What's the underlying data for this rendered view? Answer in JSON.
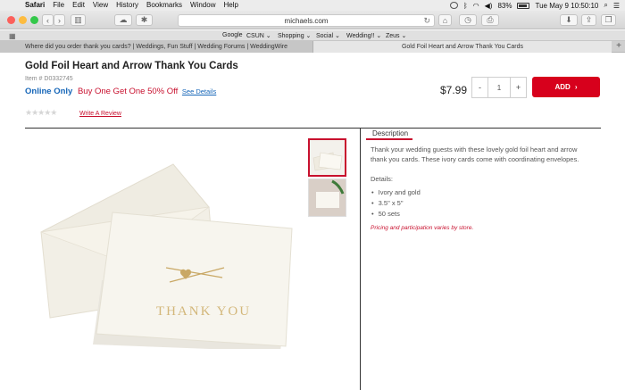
{
  "menubar": {
    "app": "Safari",
    "items": [
      "File",
      "Edit",
      "View",
      "History",
      "Bookmarks",
      "Window",
      "Help"
    ],
    "battery": "83%",
    "clock": "Tue May 9  10:50:10"
  },
  "toolbar": {
    "url": "michaels.com"
  },
  "bookmarks": {
    "items": [
      "Google",
      "CSUN ⌄",
      "Shopping ⌄",
      "Social ⌄",
      "Wedding!! ⌄",
      "Zeus ⌄"
    ]
  },
  "tabs": {
    "inactive": "Where did you order thank you cards? | Weddings, Fun Stuff | Wedding Forums | WeddingWire",
    "active": "Gold Foil Heart and Arrow Thank You Cards"
  },
  "product": {
    "title": "Gold Foil Heart and Arrow Thank You Cards",
    "item_number": "Item # D0332745",
    "online_only": "Online Only",
    "promo": "Buy One Get One 50% Off",
    "see_details": "See Details",
    "price": "$7.99",
    "quantity": "1",
    "minus": "-",
    "plus": "+",
    "add_label": "ADD",
    "stars": "★★★★★",
    "write_review": "Write A Review",
    "card_text": "THANK YOU"
  },
  "description": {
    "tab_label": "Description",
    "text": "Thank your wedding guests with these lovely gold foil heart and arrow thank you cards. These ivory cards come with coordinating envelopes.",
    "details_label": "Details:",
    "details": [
      "Ivory and gold",
      "3.5\" x 5\"",
      "50 sets"
    ],
    "disclaimer": "Pricing and participation varies by store."
  },
  "colors": {
    "brand_red": "#d7001c",
    "link_blue": "#1666b8"
  }
}
